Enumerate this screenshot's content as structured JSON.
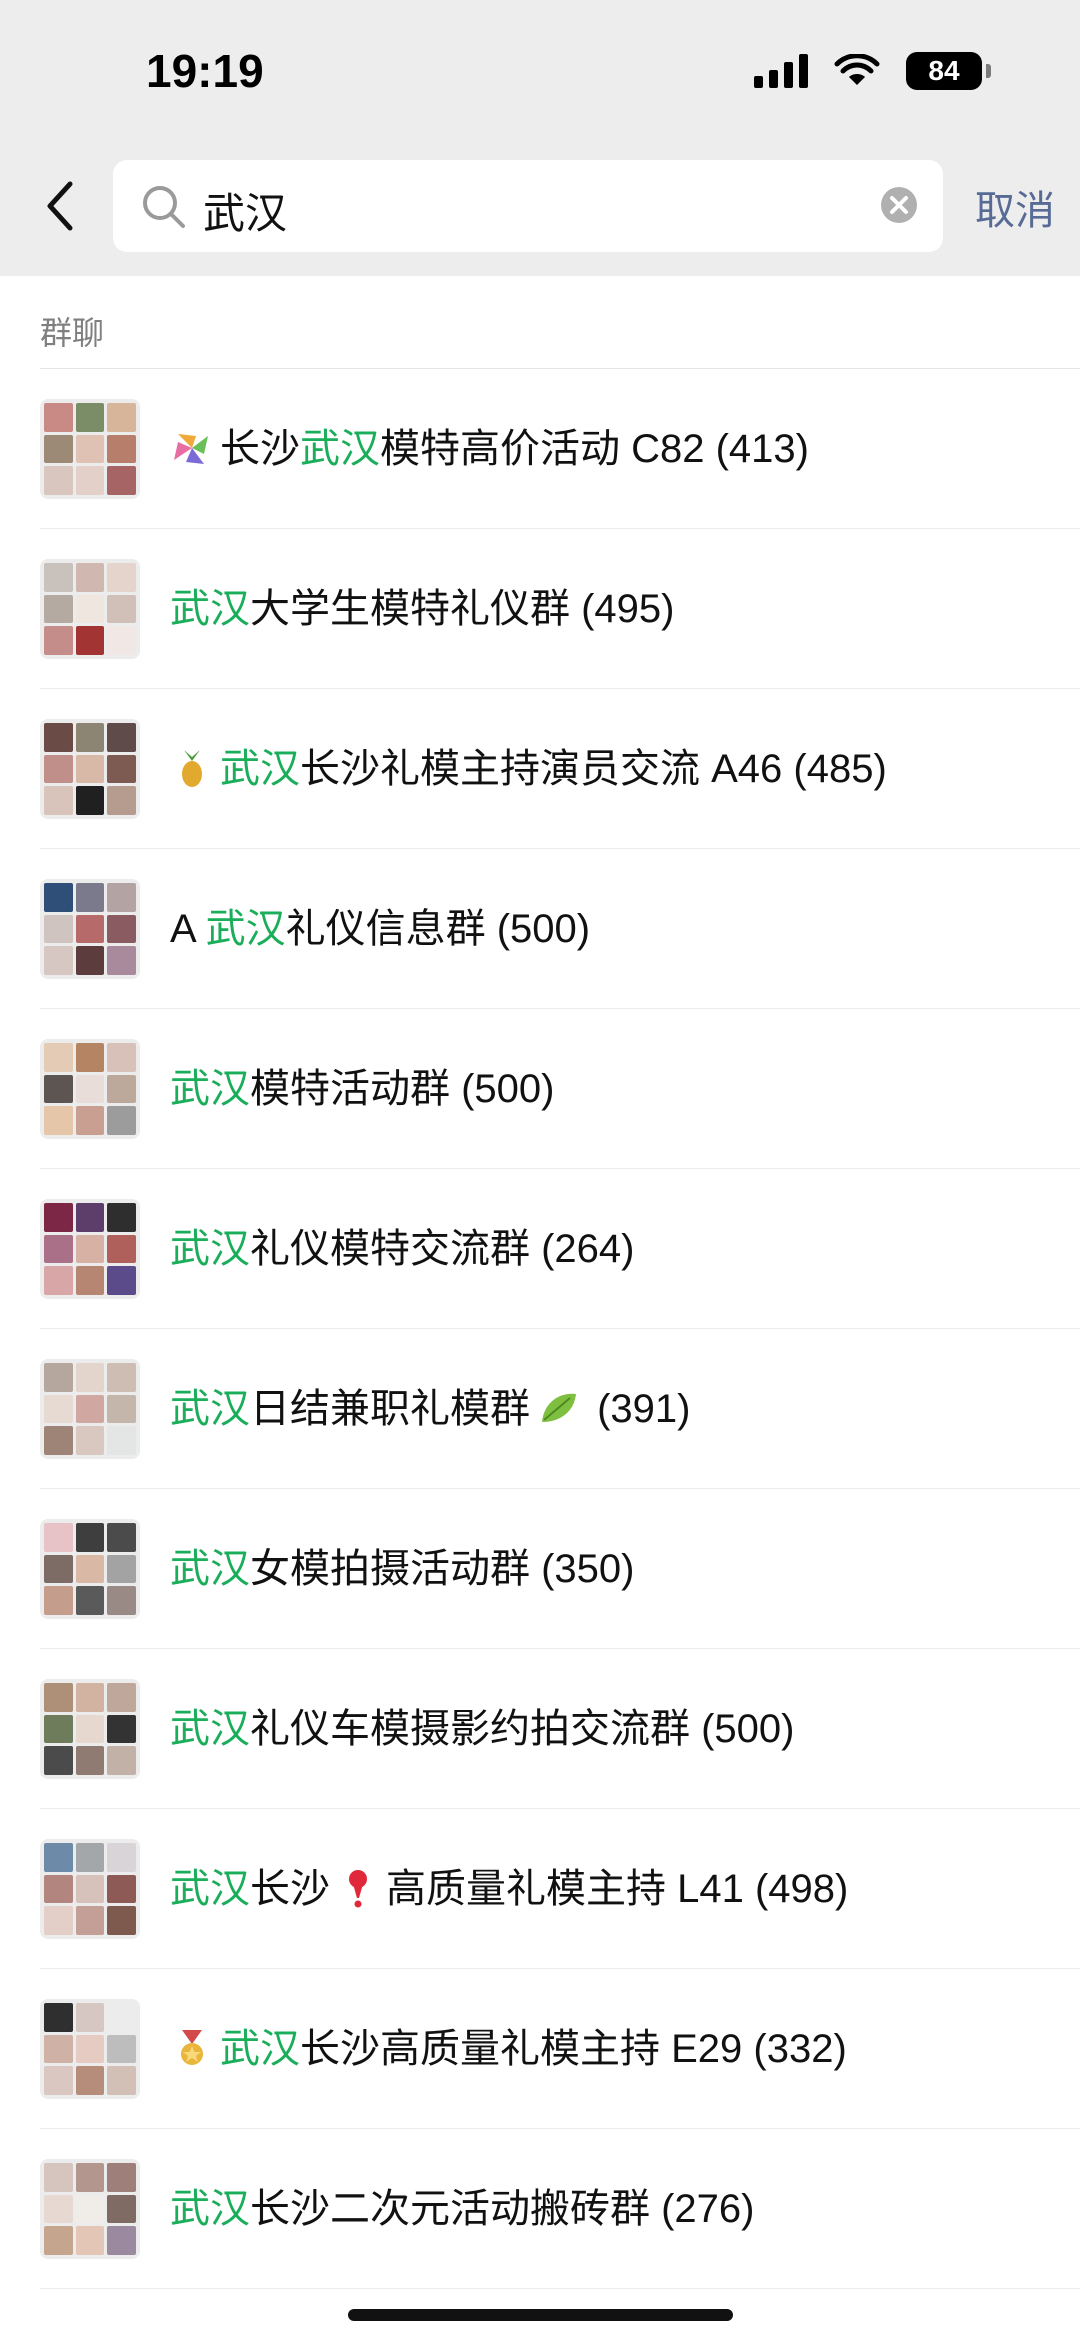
{
  "status_bar": {
    "time": "19:19",
    "battery": "84"
  },
  "search": {
    "query": "武汉",
    "cancel_label": "取消"
  },
  "section": {
    "label": "群聊"
  },
  "results": [
    {
      "emoji": "pinwheel",
      "before": "",
      "highlight": "武汉",
      "after": "模特高价活动 C82 (413)",
      "prefix": "长沙"
    },
    {
      "emoji": "",
      "before": "",
      "highlight": "武汉",
      "after": "大学生模特礼仪群 (495)",
      "prefix": ""
    },
    {
      "emoji": "pineapple",
      "before": "",
      "highlight": "武汉",
      "after": "长沙礼模主持演员交流 A46 (485)",
      "prefix": ""
    },
    {
      "emoji": "",
      "before": "A ",
      "highlight": "武汉",
      "after": "礼仪信息群 (500)",
      "prefix": ""
    },
    {
      "emoji": "",
      "before": "",
      "highlight": "武汉",
      "after": "模特活动群 (500)",
      "prefix": ""
    },
    {
      "emoji": "",
      "before": "",
      "highlight": "武汉",
      "after": "礼仪模特交流群 (264)",
      "prefix": ""
    },
    {
      "emoji": "",
      "before": "",
      "highlight": "武汉",
      "after": "日结兼职礼模群",
      "suffix_emoji": "leaf",
      "suffix": " (391)",
      "prefix": ""
    },
    {
      "emoji": "",
      "before": "",
      "highlight": "武汉",
      "after": "女模拍摄活动群 (350)",
      "prefix": ""
    },
    {
      "emoji": "",
      "before": "",
      "highlight": "武汉",
      "after": "礼仪车模摄影约拍交流群 (500)",
      "prefix": ""
    },
    {
      "emoji": "",
      "before": "",
      "highlight": "武汉",
      "after": "长沙",
      "mid_emoji": "exclamation",
      "after2": "高质量礼模主持 L41 (498)",
      "prefix": ""
    },
    {
      "emoji": "medal",
      "before": "",
      "highlight": "武汉",
      "after": "长沙高质量礼模主持 E29 (332)",
      "prefix": ""
    },
    {
      "emoji": "",
      "before": "",
      "highlight": "武汉",
      "after": "长沙二次元活动搬砖群 (276)",
      "prefix": ""
    }
  ],
  "colors": {
    "highlight": "#1aad5a",
    "cancel": "#576b95"
  }
}
